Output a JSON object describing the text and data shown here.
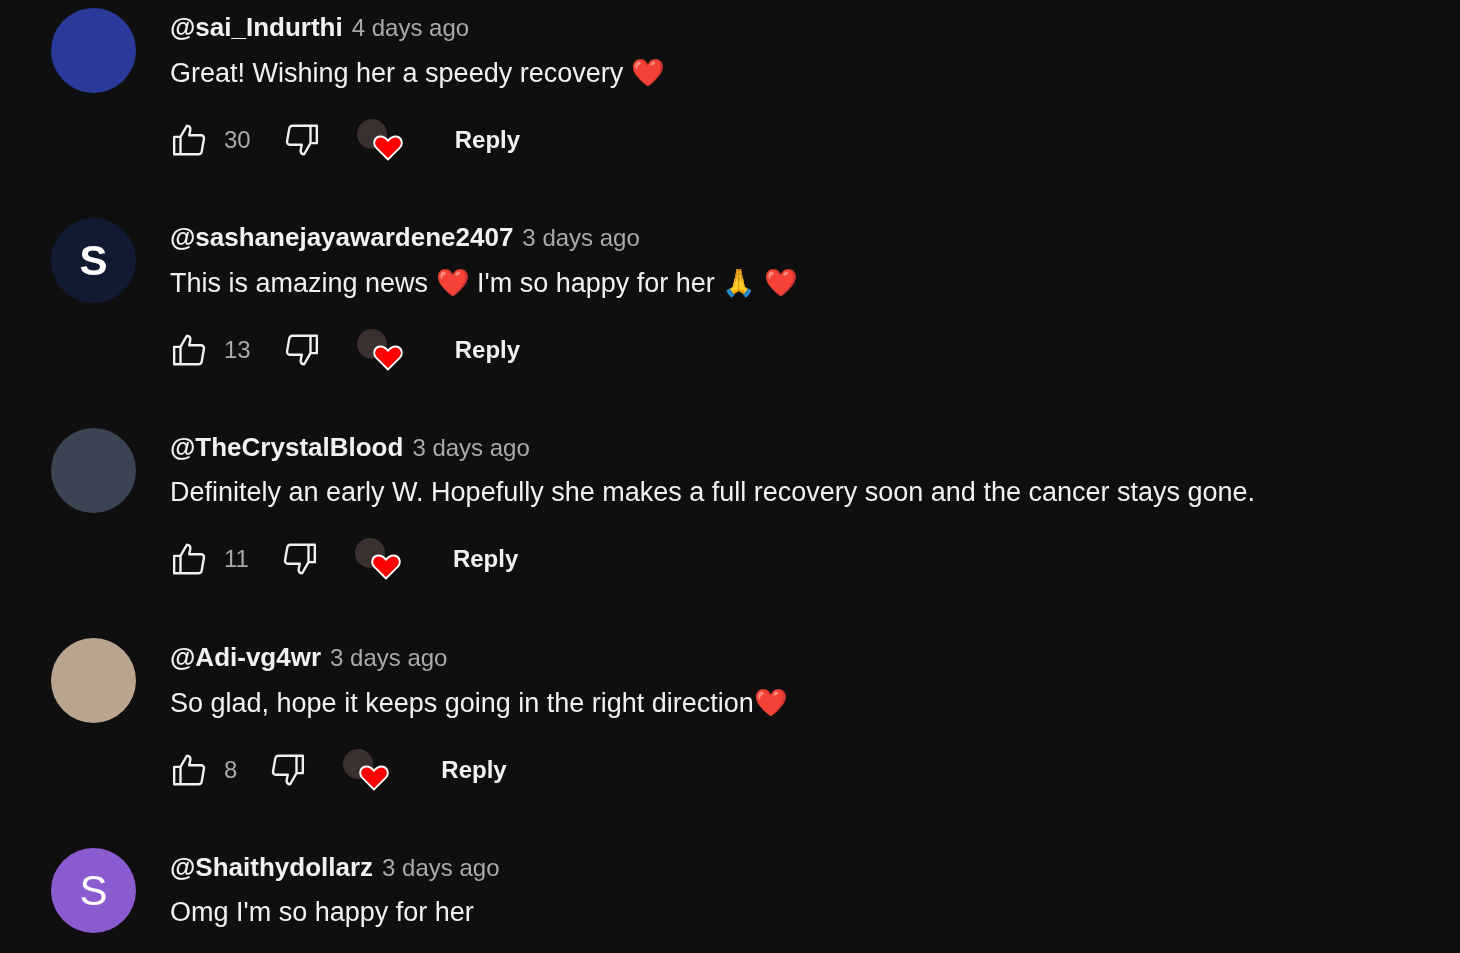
{
  "comments": [
    {
      "author": "@sai_Indurthi",
      "time": "4 days ago",
      "text": "Great! Wishing her a speedy recovery ❤️",
      "avatar": {
        "kind": "image",
        "color": "#2b3a9a"
      },
      "likes": "30",
      "hearted": true,
      "reply": "Reply"
    },
    {
      "author": "@sashanejayawardene2407",
      "time": "3 days ago",
      "text": "This is amazing news ❤️ I'm so happy for her 🙏 ❤️",
      "avatar": {
        "kind": "letter",
        "letter": "S",
        "color": "#101a30"
      },
      "likes": "13",
      "hearted": true,
      "reply": "Reply"
    },
    {
      "author": "@TheCrystalBlood",
      "time": "3 days ago",
      "text": "Definitely an early W. Hopefully she makes a full recovery soon and the cancer stays gone.",
      "avatar": {
        "kind": "image",
        "color": "#3a4452"
      },
      "likes": "11",
      "hearted": true,
      "reply": "Reply"
    },
    {
      "author": "@Adi-vg4wr",
      "time": "3 days ago",
      "text": "So glad, hope it keeps going in the right direction❤️",
      "avatar": {
        "kind": "image",
        "color": "#b9a58e"
      },
      "likes": "8",
      "hearted": true,
      "reply": "Reply"
    },
    {
      "author": "@Shaithydollarz",
      "time": "3 days ago",
      "text": "Omg I'm so happy for her",
      "avatar": {
        "kind": "letter",
        "letter": "S",
        "color": "#8a5cd0"
      }
    }
  ]
}
